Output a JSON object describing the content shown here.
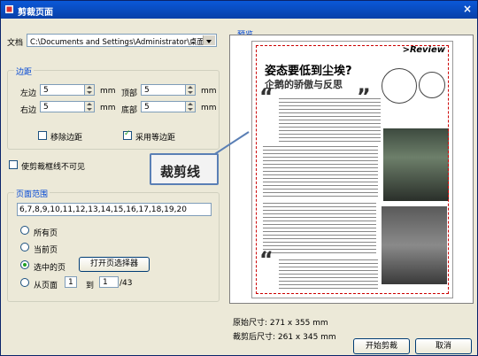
{
  "window": {
    "title": "剪裁页面",
    "close": "×"
  },
  "document": {
    "label": "文档",
    "value": "C:\\Documents and Settings\\Administrator\\桌面\\世界经济"
  },
  "margins": {
    "legend": "边距",
    "left": {
      "label": "左边",
      "value": "5",
      "unit": "mm"
    },
    "top": {
      "label": "顶部",
      "value": "5",
      "unit": "mm"
    },
    "right": {
      "label": "右边",
      "value": "5",
      "unit": "mm"
    },
    "bottom": {
      "label": "底部",
      "value": "5",
      "unit": "mm"
    },
    "remove_margins": {
      "label": "移除边距",
      "checked": false
    },
    "equal_margins": {
      "label": "采用等边距",
      "checked": true
    }
  },
  "invisible_box": {
    "label": "使剪裁框线不可见",
    "checked": false
  },
  "page_range": {
    "legend": "页面范围",
    "pages_text": "6,7,8,9,10,11,12,13,14,15,16,17,18,19,20",
    "all_pages": "所有页",
    "current_page": "当前页",
    "selected_pages": "选中的页",
    "open_selector": "打开页选择器",
    "from_page": "从页面",
    "from_value": "1",
    "to_label": "到",
    "to_value": "1",
    "total": "/43"
  },
  "preview": {
    "legend": "预览",
    "callout": "裁剪线",
    "article_title": "姿态要低到尘埃?",
    "article_subtitle": "企鹅的骄傲与反思",
    "review_tag": ">Review",
    "quote_open": "“",
    "quote_close": "”"
  },
  "sizes": {
    "original": "原始尺寸: 271 x 355 mm",
    "cropped": "裁剪后尺寸: 261 x 345 mm"
  },
  "buttons": {
    "start": "开始剪裁",
    "cancel": "取消"
  },
  "colors": {
    "accent": "#0046d5",
    "titlebar": "#0a58d8",
    "crop_line": "#cc0000"
  }
}
